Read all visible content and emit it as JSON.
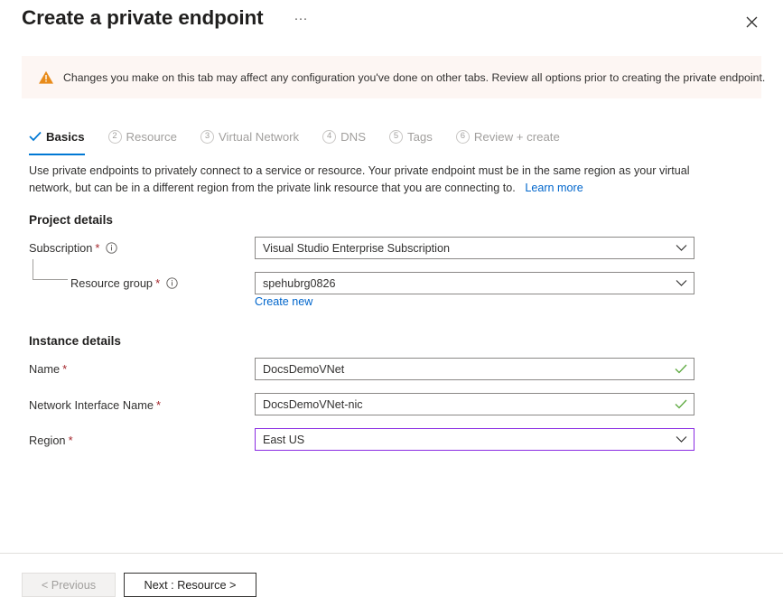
{
  "header": {
    "title": "Create a private endpoint",
    "ellipsis_label": "···",
    "ellipsis_icon": "more-ellipsis-icon",
    "close_icon": "close-icon"
  },
  "warning": {
    "icon": "warning-triangle-icon",
    "icon_color": "#e88b1a",
    "background": "#fdf6f3",
    "text": "Changes you make on this tab may affect any configuration you've done on other tabs. Review all options prior to creating the private endpoint."
  },
  "tabs": [
    {
      "label": "Basics",
      "marker": "✓",
      "active": true,
      "type": "check"
    },
    {
      "label": "Resource",
      "marker": "2",
      "active": false,
      "type": "number"
    },
    {
      "label": "Virtual Network",
      "marker": "3",
      "active": false,
      "type": "number"
    },
    {
      "label": "DNS",
      "marker": "4",
      "active": false,
      "type": "number"
    },
    {
      "label": "Tags",
      "marker": "5",
      "active": false,
      "type": "number"
    },
    {
      "label": "Review + create",
      "marker": "6",
      "active": false,
      "type": "number"
    }
  ],
  "description": {
    "text": "Use private endpoints to privately connect to a service or resource. Your private endpoint must be in the same region as your virtual network, but can be in a different region from the private link resource that you are connecting to.",
    "link_label": "Learn more"
  },
  "project_details": {
    "heading": "Project details",
    "subscription": {
      "label": "Subscription",
      "required": "*",
      "info_icon": "info-circle-icon",
      "value": "Visual Studio Enterprise Subscription",
      "chevron_icon": "chevron-down-icon"
    },
    "resource_group": {
      "label": "Resource group",
      "required": "*",
      "info_icon": "info-circle-icon",
      "value": "spehubrg0826",
      "chevron_icon": "chevron-down-icon",
      "create_new_label": "Create new"
    }
  },
  "instance_details": {
    "heading": "Instance details",
    "name": {
      "label": "Name",
      "required": "*",
      "value": "DocsDemoVNet",
      "valid_icon": "checkmark-valid-icon",
      "valid_color": "#5ba83d"
    },
    "nic_name": {
      "label": "Network Interface Name",
      "required": "*",
      "value": "DocsDemoVNet-nic",
      "valid_icon": "checkmark-valid-icon",
      "valid_color": "#5ba83d"
    },
    "region": {
      "label": "Region",
      "required": "*",
      "value": "East US",
      "chevron_icon": "chevron-down-icon",
      "focused": true,
      "focus_border_color": "#8a2be2"
    }
  },
  "footer": {
    "previous_label": "< Previous",
    "next_label": "Next : Resource >"
  },
  "colors": {
    "accent": "#0078d4",
    "link": "#0066cc",
    "required_asterisk": "#a4262c",
    "warning": "#e88b1a"
  }
}
